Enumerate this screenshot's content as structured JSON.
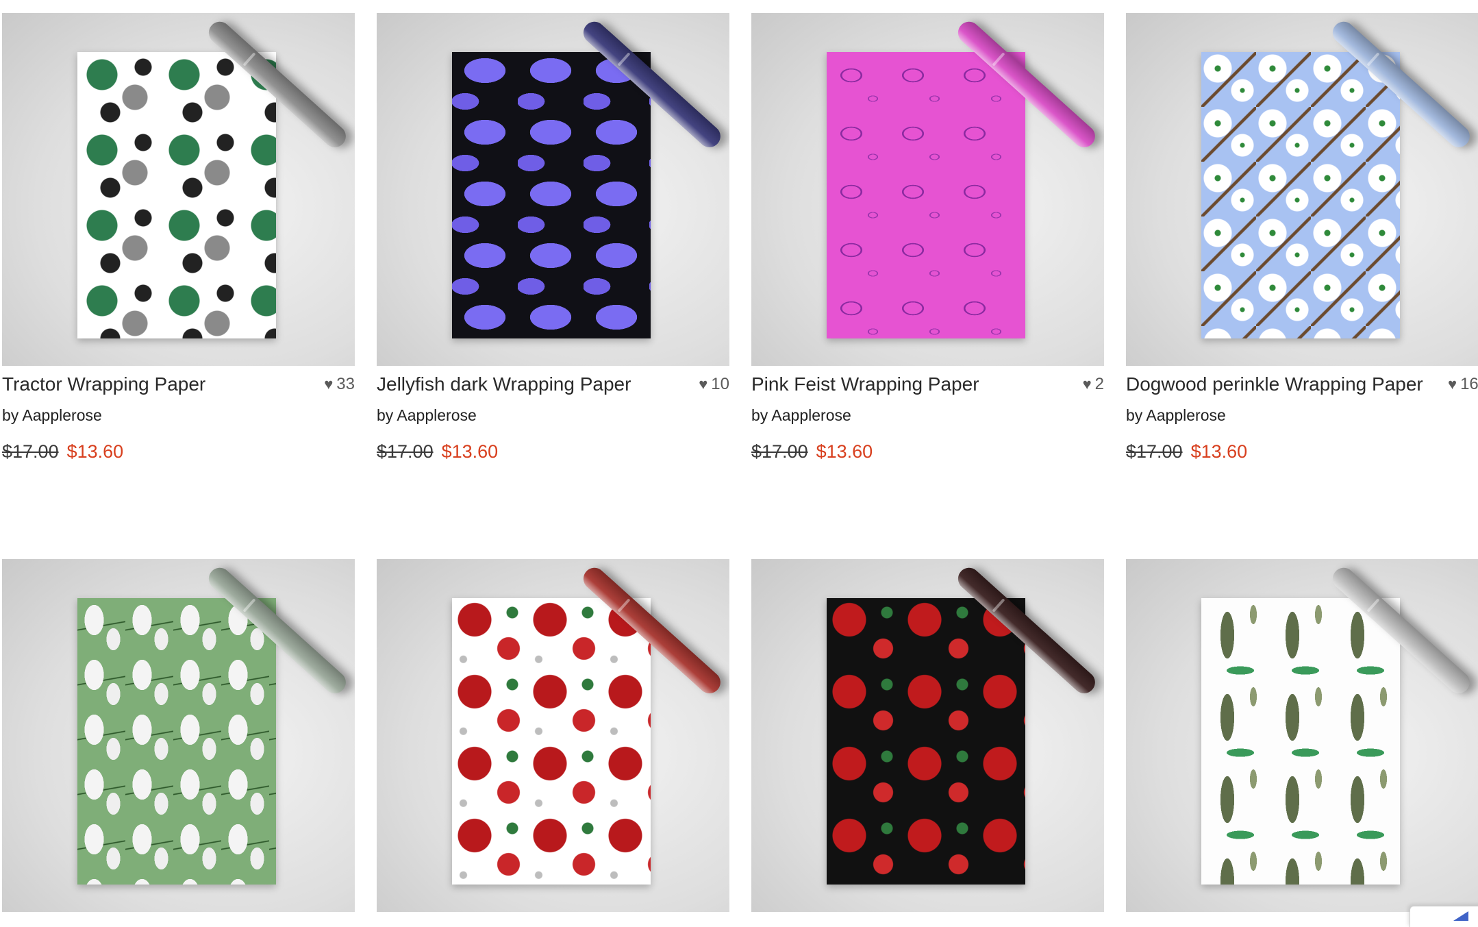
{
  "products": [
    {
      "title": "Tractor Wrapping Paper",
      "likes": "33",
      "byline_prefix": "by",
      "artist": "Aapplerose",
      "old_price": "$17.00",
      "sale_price": "$13.60",
      "pattern": "tractor-pattern",
      "colors": {
        "primary": "#2e7d4f",
        "secondary": "#8a8a8a"
      }
    },
    {
      "title": "Jellyfish dark Wrapping Paper",
      "likes": "10",
      "byline_prefix": "by",
      "artist": "Aapplerose",
      "old_price": "$17.00",
      "sale_price": "$13.60",
      "pattern": "jellyfish-pattern",
      "colors": {
        "primary": "#7a6cf2",
        "secondary": "#101016"
      }
    },
    {
      "title": "Pink Feist Wrapping Paper",
      "likes": "2",
      "byline_prefix": "by",
      "artist": "Aapplerose",
      "old_price": "$17.00",
      "sale_price": "$13.60",
      "pattern": "dog-pattern",
      "colors": {
        "primary": "#e653d2",
        "secondary": "#8b2aa0"
      }
    },
    {
      "title": "Dogwood perinkle Wrapping Paper",
      "likes": "16",
      "byline_prefix": "by",
      "artist": "Aapplerose",
      "old_price": "$17.00",
      "sale_price": "$13.60",
      "pattern": "dogwood-pattern",
      "colors": {
        "primary": "#a8c2f2",
        "secondary": "#ffffff"
      }
    },
    {
      "pattern": "goat-pattern",
      "colors": {
        "primary": "#7fae78",
        "secondary": "#f4f4f4"
      }
    },
    {
      "pattern": "poinsettia-white-pattern",
      "colors": {
        "primary": "#b8191c",
        "secondary": "#ffffff"
      }
    },
    {
      "pattern": "poinsettia-black-pattern",
      "colors": {
        "primary": "#c01b1d",
        "secondary": "#111111"
      }
    },
    {
      "pattern": "pine-tree-pattern",
      "colors": {
        "primary": "#5f6e4a",
        "secondary": "#fdfdfd"
      }
    }
  ],
  "theme": {
    "sale_color": "#d8401f",
    "text_color": "#2a2a2a",
    "heart_icon": "heart-icon"
  },
  "widget": {
    "icon": "badge-icon"
  }
}
